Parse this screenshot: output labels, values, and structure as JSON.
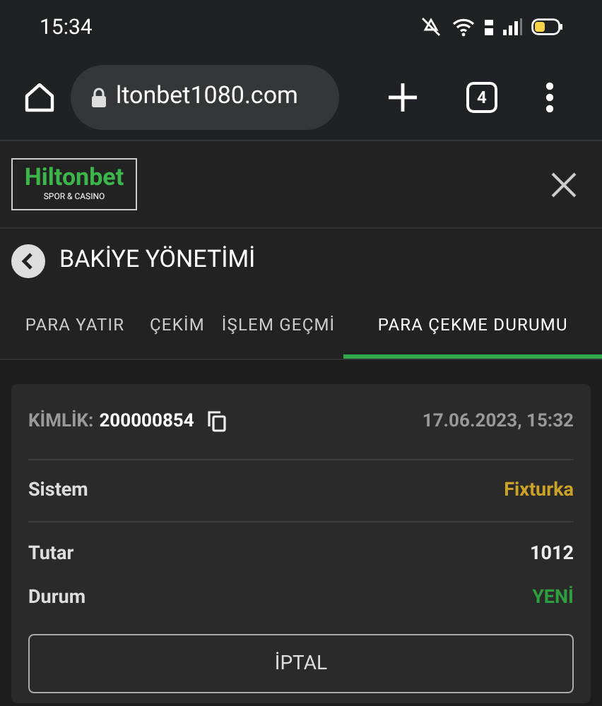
{
  "status_bar": {
    "time": "15:34"
  },
  "browser": {
    "url": "ltonbet1080.com",
    "tab_count": "4"
  },
  "site_header": {
    "logo": "Hiltonbet",
    "logo_tagline": "SPOR & CASINO"
  },
  "page_title": "BAKİYE YÖNETİMİ",
  "tabs": [
    {
      "label": "PARA YATIR",
      "selected": false
    },
    {
      "label": "ÇEKİM",
      "selected": false
    },
    {
      "label": "İŞLEM GEÇMİ",
      "selected": false
    },
    {
      "label": "PARA ÇEKME DURUMU",
      "selected": true
    }
  ],
  "withdrawal": {
    "id_label": "KİMLİK:",
    "id": "200000854",
    "date": "17.06.2023, 15:32",
    "rows": [
      {
        "label": "Sistem",
        "value": "Fixturka",
        "color": "#c9a227",
        "divider": true
      },
      {
        "label": "Tutar",
        "value": "1012",
        "color": "#eeeeee",
        "divider": false
      },
      {
        "label": "Durum",
        "value": "YENİ",
        "color": "#2e9e3e",
        "divider": false
      }
    ],
    "cancel_button": "İPTAL"
  }
}
